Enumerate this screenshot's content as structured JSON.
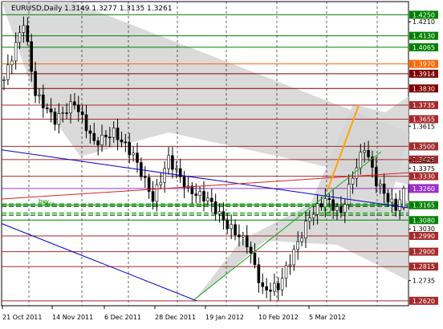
{
  "header": {
    "symbol": "EURUSD,Daily",
    "ohlc": "1.3149 1.3277 1.3135 1.3261"
  },
  "chart_data": {
    "type": "candlestick",
    "instrument": "EURUSD",
    "timeframe": "Daily",
    "last_bar": {
      "open": 1.3149,
      "high": 1.3277,
      "low": 1.3135,
      "close": 1.3261
    },
    "ylim": [
      1.2592,
      1.4325
    ],
    "grid": true,
    "x_tick_labels": [
      "21 Oct 2011",
      "14 Nov 2011",
      "6 Dec 2011",
      "28 Dec 2011",
      "19 Jan 2012",
      "10 Feb 2012",
      "5 Mar 2012"
    ],
    "y_tick_labels": [
      "1.4250",
      "1.4130",
      "1.4065",
      "1.3970",
      "1.3914",
      "1.3830",
      "1.3735",
      "1.3655",
      "1.3615",
      "1.3500",
      "1.3425",
      "1.3330",
      "1.3260",
      "1.3165",
      "1.3080",
      "1.2990",
      "1.2900",
      "1.2815",
      "1.2735",
      "1.2620"
    ],
    "plain_tick_labels": [
      "1.4210",
      "1.3375",
      "1.3615",
      "1.3420",
      "1.3030",
      "1.2735"
    ],
    "levels": [
      {
        "price": 1.425,
        "color": "#008000"
      },
      {
        "price": 1.413,
        "color": "#008000"
      },
      {
        "price": 1.4065,
        "color": "#008000"
      },
      {
        "price": 1.397,
        "color": "#ff6600"
      },
      {
        "price": 1.3914,
        "color": "#800000"
      },
      {
        "price": 1.383,
        "color": "#800000"
      },
      {
        "price": 1.3735,
        "color": "#a52a2a"
      },
      {
        "price": 1.3655,
        "color": "#a52a2a"
      },
      {
        "price": 1.35,
        "color": "#a52a2a"
      },
      {
        "price": 1.3425,
        "color": "#a52a2a"
      },
      {
        "price": 1.333,
        "color": "#a52a2a"
      },
      {
        "price": 1.326,
        "color": "#9932cc"
      },
      {
        "price": 1.3165,
        "color": "#008000"
      },
      {
        "price": 1.308,
        "color": "#008000"
      },
      {
        "price": 1.299,
        "color": "#a52a2a"
      },
      {
        "price": 1.29,
        "color": "#a52a2a"
      },
      {
        "price": 1.2815,
        "color": "#a52a2a"
      },
      {
        "price": 1.262,
        "color": "#a52a2a"
      }
    ],
    "order_labels": [
      "buy",
      "buy"
    ],
    "colors": {
      "background": "#ffffff",
      "candles": "#000000",
      "channel": "#d3d3d3",
      "trendline": "#0000cc",
      "red_trendline": "#dd2222",
      "green_trendline": "#22aa22",
      "projection": "#ffa500"
    }
  }
}
